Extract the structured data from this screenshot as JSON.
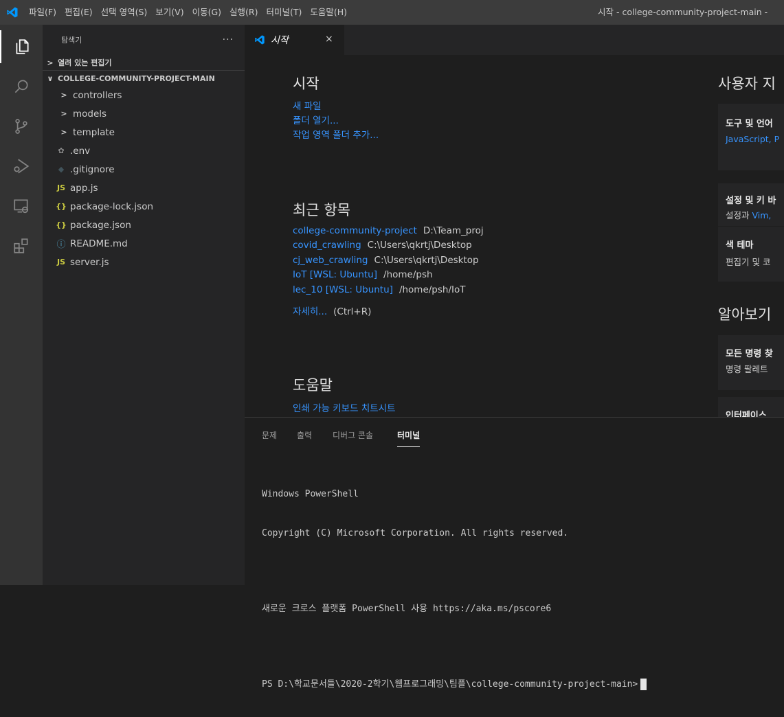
{
  "titlebar": {
    "menu": [
      "파일(F)",
      "편집(E)",
      "선택 영역(S)",
      "보기(V)",
      "이동(G)",
      "실행(R)",
      "터미널(T)",
      "도움말(H)"
    ],
    "window_title": "시작 - college-community-project-main -"
  },
  "activity": {
    "icons": [
      "explorer-icon",
      "search-icon",
      "source-control-icon",
      "run-debug-icon",
      "remote-explorer-icon",
      "extensions-icon"
    ]
  },
  "sidebar": {
    "title": "탐색기",
    "more": "···",
    "open_editors": "열려 있는 편집기",
    "root": "COLLEGE-COMMUNITY-PROJECT-MAIN",
    "folders": [
      "controllers",
      "models",
      "template"
    ],
    "files": [
      {
        "name": ".env",
        "icon": "gear-icon",
        "glyph": "✿",
        "color": "#8e8e8e"
      },
      {
        "name": ".gitignore",
        "icon": "git-icon",
        "glyph": "◆",
        "color": "#41535b"
      },
      {
        "name": "app.js",
        "icon": "js-icon",
        "glyph": "JS",
        "color": "#cbcb41"
      },
      {
        "name": "package-lock.json",
        "icon": "json-icon",
        "glyph": "{}",
        "color": "#cbcb41"
      },
      {
        "name": "package.json",
        "icon": "json-icon",
        "glyph": "{}",
        "color": "#cbcb41"
      },
      {
        "name": "README.md",
        "icon": "info-icon",
        "glyph": "ⓘ",
        "color": "#519aba"
      },
      {
        "name": "server.js",
        "icon": "js-icon",
        "glyph": "JS",
        "color": "#cbcb41"
      }
    ]
  },
  "tabs": [
    {
      "label": "시작",
      "close": "×"
    }
  ],
  "welcome": {
    "start": {
      "heading": "시작",
      "links": [
        "새 파일",
        "폴더 열기...",
        "작업 영역 폴더 추가..."
      ]
    },
    "recent": {
      "heading": "최근 항목",
      "items": [
        {
          "name": "college-community-project",
          "path": "D:\\Team_proj"
        },
        {
          "name": "covid_crawling",
          "path": "C:\\Users\\qkrtj\\Desktop"
        },
        {
          "name": "cj_web_crawling",
          "path": "C:\\Users\\qkrtj\\Desktop"
        },
        {
          "name": "IoT [WSL: Ubuntu]",
          "path": "/home/psh"
        },
        {
          "name": "lec_10 [WSL: Ubuntu]",
          "path": "/home/psh/IoT"
        }
      ],
      "more": "자세히...",
      "more_hint": "(Ctrl+R)"
    },
    "help": {
      "heading": "도움말",
      "links": [
        "인쇄 가능 키보드 치트시트"
      ]
    },
    "customize": {
      "heading": "사용자 지",
      "cards": [
        {
          "title": "도구 및 언어",
          "desc_link": "JavaScript, P",
          "desc": ""
        },
        {
          "title": "설정 및 키 바",
          "desc": "설정과 ",
          "desc_link": "Vim,"
        },
        {
          "title": "색 테마",
          "desc": "편집기 및 코",
          "desc_link": ""
        }
      ]
    },
    "learn": {
      "heading": "알아보기",
      "cards": [
        {
          "title": "모든 명령 찾",
          "desc": "명령 팔레트"
        },
        {
          "title": "인터페이스",
          "desc": ""
        }
      ]
    }
  },
  "panel": {
    "tabs": [
      "문제",
      "출력",
      "디버그 콘솔",
      "터미널"
    ],
    "active_tab": "터미널",
    "terminal": {
      "lines": [
        "Windows PowerShell",
        "Copyright (C) Microsoft Corporation. All rights reserved."
      ],
      "line2": "새로운 크로스 플랫폼 PowerShell 사용 https://aka.ms/pscore6",
      "prompt": "PS D:\\학교문서들\\2020-2학기\\웹프로그래밍\\팀플\\college-community-project-main>"
    }
  },
  "colors": {
    "accent": "#3794ff",
    "vscode_blue": "#0098ff"
  }
}
